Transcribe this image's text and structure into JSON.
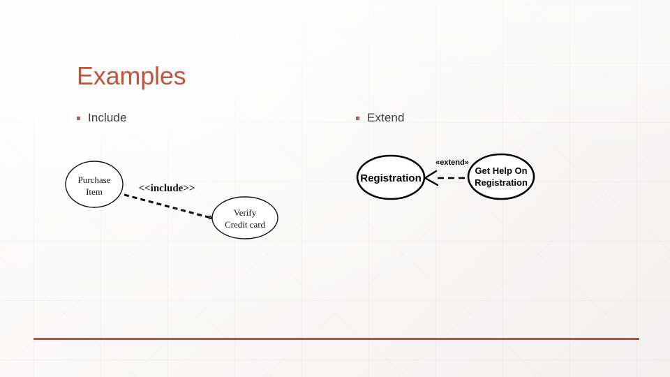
{
  "slide": {
    "title": "Examples",
    "title_color": "#C0553C",
    "accent_rule_color": "#9C5B49",
    "bullet_marker_color": "#A9624E",
    "background_color": "#FBFAFA"
  },
  "bullets": [
    {
      "label": "Include",
      "marker": "square-bullet"
    },
    {
      "label": "Extend",
      "marker": "square-bullet"
    }
  ],
  "diagrams": [
    {
      "id": "include-diagram",
      "caption": "Include",
      "relationship": "<<include>>",
      "arrow_style": "dashed-open-arrow",
      "nodes": [
        {
          "id": "purchase-item",
          "lines": [
            "Purchase",
            "Item"
          ],
          "shape": "ellipse"
        },
        {
          "id": "verify-credit-card",
          "lines": [
            "Verify",
            "Credit card"
          ],
          "shape": "ellipse"
        }
      ],
      "edge": {
        "from": "purchase-item",
        "to": "verify-credit-card",
        "label": "<<include>>"
      }
    },
    {
      "id": "extend-diagram",
      "caption": "Extend",
      "relationship": "«extend»",
      "arrow_style": "dashed-open-arrow",
      "nodes": [
        {
          "id": "registration",
          "lines": [
            "Registration"
          ],
          "shape": "ellipse"
        },
        {
          "id": "get-help-on-registration",
          "lines": [
            "Get Help On",
            "Registration"
          ],
          "shape": "ellipse"
        }
      ],
      "edge": {
        "from": "get-help-on-registration",
        "to": "registration",
        "label": "«extend»"
      }
    }
  ]
}
